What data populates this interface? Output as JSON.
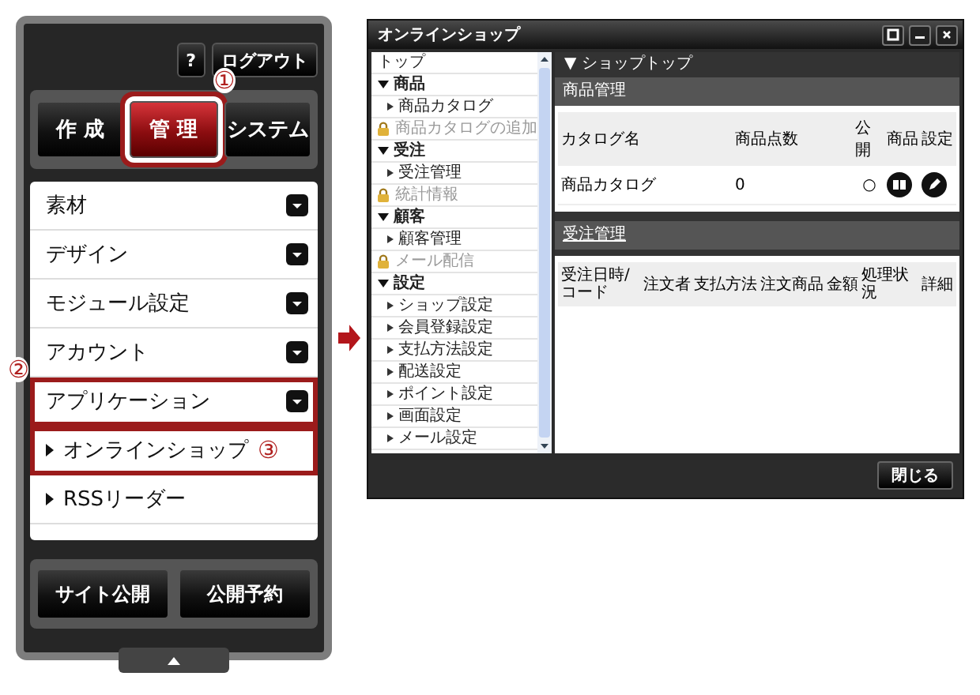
{
  "cms_panel": {
    "help_button": "?",
    "logout_button": "ログアウト",
    "mode_tabs": [
      {
        "label": "作 成",
        "selected": false
      },
      {
        "label": "管 理",
        "selected": true,
        "callout": "①"
      },
      {
        "label": "システム",
        "selected": false
      }
    ],
    "menu": [
      {
        "label": "素材",
        "kind": "category"
      },
      {
        "label": "デザイン",
        "kind": "category"
      },
      {
        "label": "モジュール設定",
        "kind": "category"
      },
      {
        "label": "アカウント",
        "kind": "category"
      },
      {
        "label": "アプリケーション",
        "kind": "category",
        "callout": "②"
      },
      {
        "label": "オンラインショップ",
        "kind": "app",
        "callout": "③"
      },
      {
        "label": "RSSリーダー",
        "kind": "app"
      }
    ],
    "footer_buttons": [
      "サイト公開",
      "公開予約"
    ]
  },
  "window": {
    "title": "オンラインショップ",
    "sidebar": [
      {
        "label": "トップ",
        "kind": "link"
      },
      {
        "label": "商品",
        "kind": "section",
        "expanded": true,
        "children": [
          {
            "label": "商品カタログ",
            "kind": "link"
          },
          {
            "label": "商品カタログの追加",
            "kind": "locked"
          }
        ]
      },
      {
        "label": "受注",
        "kind": "section",
        "expanded": true,
        "children": [
          {
            "label": "受注管理",
            "kind": "link"
          },
          {
            "label": "統計情報",
            "kind": "locked"
          }
        ]
      },
      {
        "label": "顧客",
        "kind": "section",
        "expanded": true,
        "children": [
          {
            "label": "顧客管理",
            "kind": "link"
          },
          {
            "label": "メール配信",
            "kind": "locked"
          }
        ]
      },
      {
        "label": "設定",
        "kind": "section",
        "expanded": true,
        "children": [
          {
            "label": "ショップ設定",
            "kind": "link"
          },
          {
            "label": "会員登録設定",
            "kind": "link"
          },
          {
            "label": "支払方法設定",
            "kind": "link"
          },
          {
            "label": "配送設定",
            "kind": "link"
          },
          {
            "label": "ポイント設定",
            "kind": "link"
          },
          {
            "label": "画面設定",
            "kind": "link"
          },
          {
            "label": "メール設定",
            "kind": "link"
          }
        ]
      }
    ],
    "breadcrumb": "▼ ショップトップ",
    "catalog_section": {
      "title": "商品管理",
      "columns": [
        "カタログ名",
        "商品点数",
        "公開",
        "商品",
        "設定"
      ],
      "rows": [
        {
          "name": "商品カタログ",
          "count": "0",
          "public": "○"
        }
      ]
    },
    "orders_section": {
      "title": "受注管理",
      "columns": [
        "受注日時/コード",
        "注文者",
        "支払方法",
        "注文商品",
        "金額",
        "処理状況",
        "詳細"
      ]
    },
    "close_button": "閉じる"
  }
}
